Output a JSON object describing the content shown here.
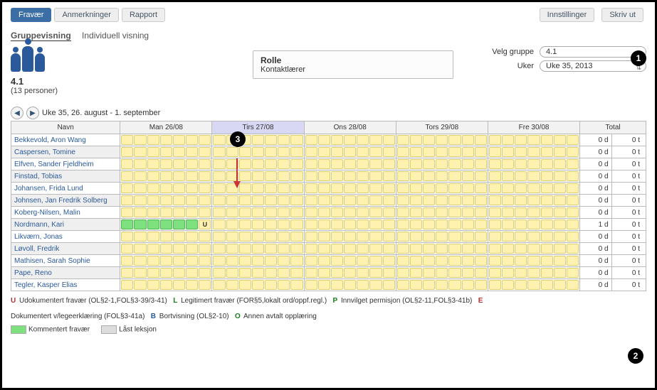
{
  "tabs": {
    "absence": "Fravær",
    "remarks": "Anmerkninger",
    "report": "Rapport",
    "settings": "Innstillinger",
    "print": "Skriv ut"
  },
  "views": {
    "group": "Gruppevisning",
    "individual": "Individuell visning"
  },
  "group": {
    "name": "4.1",
    "sub": "(13 personer)"
  },
  "role": {
    "title": "Rolle",
    "value": "Kontaktlærer"
  },
  "selectors": {
    "group_label": "Velg gruppe",
    "group_value": "4.1",
    "week_label": "Uker",
    "week_value": "Uke 35, 2013"
  },
  "weeknav": {
    "range": "Uke 35, 26. august - 1. september"
  },
  "columns": {
    "name": "Navn",
    "mon": "Man 26/08",
    "tue": "Tirs 27/08",
    "wed": "Ons 28/08",
    "thu": "Tors 29/08",
    "fri": "Fre 30/08",
    "total": "Total"
  },
  "students": [
    {
      "name": "Bekkevold, Aron Wang",
      "d": "0 d",
      "t": "0 t"
    },
    {
      "name": "Caspersen, Tomine",
      "d": "0 d",
      "t": "0 t"
    },
    {
      "name": "Elfven, Sander Fjeldheim",
      "d": "0 d",
      "t": "0 t"
    },
    {
      "name": "Finstad, Tobias",
      "d": "0 d",
      "t": "0 t"
    },
    {
      "name": "Johansen, Frida Lund",
      "d": "0 d",
      "t": "0 t"
    },
    {
      "name": "Johnsen, Jan Fredrik Solberg",
      "d": "0 d",
      "t": "0 t"
    },
    {
      "name": "Koberg-Nilsen, Malin",
      "d": "0 d",
      "t": "0 t"
    },
    {
      "name": "Nordmann, Kari",
      "d": "1 d",
      "t": "0 t",
      "mon": "green_u"
    },
    {
      "name": "Likværn, Jonas",
      "d": "0 d",
      "t": "0 t"
    },
    {
      "name": "Løvoll, Fredrik",
      "d": "0 d",
      "t": "0 t"
    },
    {
      "name": "Mathisen, Sarah Sophie",
      "d": "0 d",
      "t": "0 t"
    },
    {
      "name": "Pape, Reno",
      "d": "0 d",
      "t": "0 t"
    },
    {
      "name": "Tegler, Kasper Elias",
      "d": "0 d",
      "t": "0 t"
    }
  ],
  "legend": {
    "u": "Udokumentert fravær (OL§2-1,FOL§3-39/3-41)",
    "l": "Legitimert fravær (FOR§5,lokalt ord/oppf.regl.)",
    "p": "Innvilget permisjon (OL§2-11,FOL§3-41b)",
    "e": "E",
    "doc": "Dokumentert v/legeerklæring (FOL§3-41a)",
    "b": "Bortvisning (OL§2-10)",
    "o": "Annen avtalt opplæring",
    "commented": "Kommentert fravær",
    "locked": "Låst leksjon",
    "codes": {
      "U": "U",
      "L": "L",
      "P": "P",
      "B": "B",
      "O": "O",
      "E": "E"
    }
  },
  "callouts": {
    "c1": "1",
    "c2": "2",
    "c3": "3"
  }
}
